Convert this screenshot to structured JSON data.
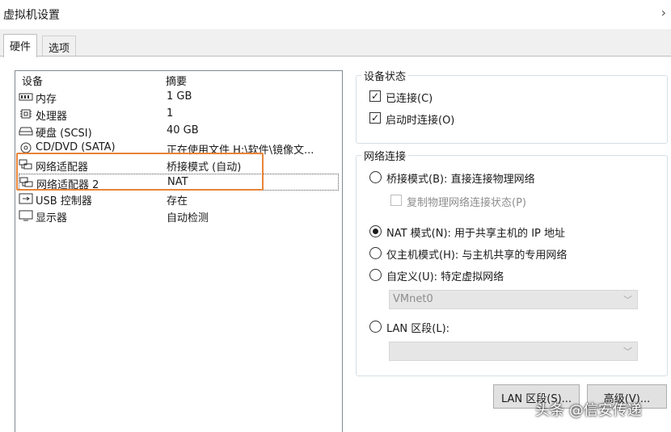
{
  "window": {
    "title": "虚拟机设置",
    "chevron": "›"
  },
  "tabs": [
    {
      "label": "硬件",
      "active": true
    },
    {
      "label": "选项",
      "active": false
    }
  ],
  "devices": {
    "header_device": "设备",
    "header_summary": "摘要",
    "rows": [
      {
        "name": "内存",
        "summary": "1 GB",
        "icon": "memory-icon"
      },
      {
        "name": "处理器",
        "summary": "1",
        "icon": "processor-icon"
      },
      {
        "name": "硬盘 (SCSI)",
        "summary": "40 GB",
        "icon": "hard-disk-icon"
      },
      {
        "name": "CD/DVD (SATA)",
        "summary": "正在使用文件 H:\\软件\\镜像文...",
        "icon": "cd-dvd-icon"
      },
      {
        "name": "网络适配器",
        "summary": "桥接模式 (自动)",
        "icon": "network-adapter-icon"
      },
      {
        "name": "网络适配器 2",
        "summary": "NAT",
        "icon": "network-adapter-icon",
        "selected": true
      },
      {
        "name": "USB 控制器",
        "summary": "存在",
        "icon": "usb-icon"
      },
      {
        "name": "显示器",
        "summary": "自动检测",
        "icon": "display-icon"
      }
    ]
  },
  "device_status": {
    "title": "设备状态",
    "connected": {
      "label": "已连接(C)",
      "checked": true
    },
    "connect_at_power_on": {
      "label": "启动时连接(O)",
      "checked": true
    }
  },
  "network": {
    "title": "网络连接",
    "bridged": {
      "label": "桥接模式(B): 直接连接物理网络",
      "selected": false
    },
    "replicate": {
      "label": "复制物理网络连接状态(P)",
      "checked": false
    },
    "nat": {
      "label": "NAT 模式(N): 用于共享主机的 IP 地址",
      "selected": true
    },
    "host_only": {
      "label": "仅主机模式(H): 与主机共享的专用网络",
      "selected": false
    },
    "custom": {
      "label": "自定义(U): 特定虚拟网络",
      "selected": false
    },
    "custom_select": {
      "value": "VMnet0"
    },
    "lan_segment": {
      "label": "LAN 区段(L):",
      "selected": false
    },
    "lan_select": {
      "value": ""
    }
  },
  "buttons": {
    "lan_segments": "LAN 区段(S)...",
    "advanced": "高级(V)..."
  },
  "watermark": "头条 @信安传递"
}
